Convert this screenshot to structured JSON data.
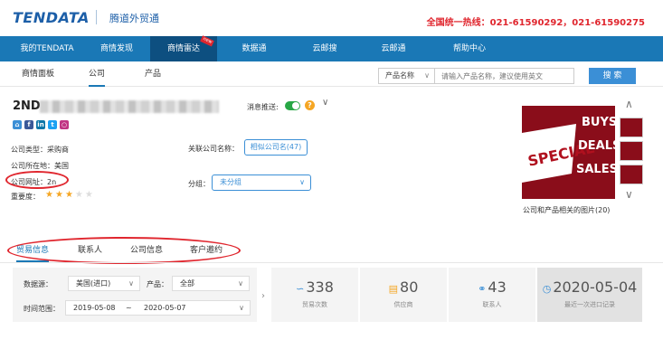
{
  "brand": {
    "logo": "TENDATA",
    "name_cn": "腾道外贸通"
  },
  "hotline": "全国统一热线：021-61590292，021-61590275",
  "nav": {
    "items": [
      "我的TENDATA",
      "商情发现",
      "商情雷达",
      "数据通",
      "云邮搜",
      "云邮通",
      "帮助中心"
    ],
    "new_badge": "new"
  },
  "subnav": {
    "items": [
      "商情面板",
      "公司",
      "产品"
    ],
    "search_select": "产品名称",
    "search_placeholder": "请输入产品名称，建议使用英文",
    "search_button": "搜 索"
  },
  "company": {
    "name_prefix": "2ND",
    "notify_label": "消息推送:",
    "help_icon": "?",
    "type": "公司类型：采购商",
    "location": "公司所在地：美国",
    "website": "公司网址：2n",
    "importance": "重要度：",
    "stars_filled": 3,
    "stars_total": 5,
    "related_label": "关联公司名称：",
    "related_button": "相似公司名(47)",
    "group_label": "分组：",
    "group_value": "未分组",
    "social_icons": [
      "home-icon",
      "facebook-icon",
      "linkedin-icon",
      "twitter-icon",
      "instagram-icon"
    ],
    "photo_caption": "公司和产品相关的图片(20)",
    "photo_text": [
      "BUYS",
      "DEALS",
      "SALES",
      "SPECIAL"
    ]
  },
  "tabs": [
    "贸易信息",
    "联系人",
    "公司信息",
    "客户邀约"
  ],
  "filters": {
    "db_label": "数据源：",
    "db_value": "美国(进口)",
    "product_label": "产品：",
    "product_value": "全部",
    "time_label": "时间范围：",
    "date_from": "2019-05-08",
    "date_sep": "~",
    "date_to": "2020-05-07"
  },
  "stats": [
    {
      "value": "338",
      "label": "贸易次数",
      "icon": "chart-icon"
    },
    {
      "value": "80",
      "label": "供应商",
      "icon": "cart-icon"
    },
    {
      "value": "43",
      "label": "联系人",
      "icon": "people-icon"
    },
    {
      "value": "2020-05-04",
      "label": "最近一次进口记录",
      "icon": "clock-icon"
    }
  ],
  "colors": {
    "primary": "#1a78b6",
    "nav_active": "#0d4f80",
    "hotline": "#e0262e",
    "annotation": "#e0262e"
  }
}
